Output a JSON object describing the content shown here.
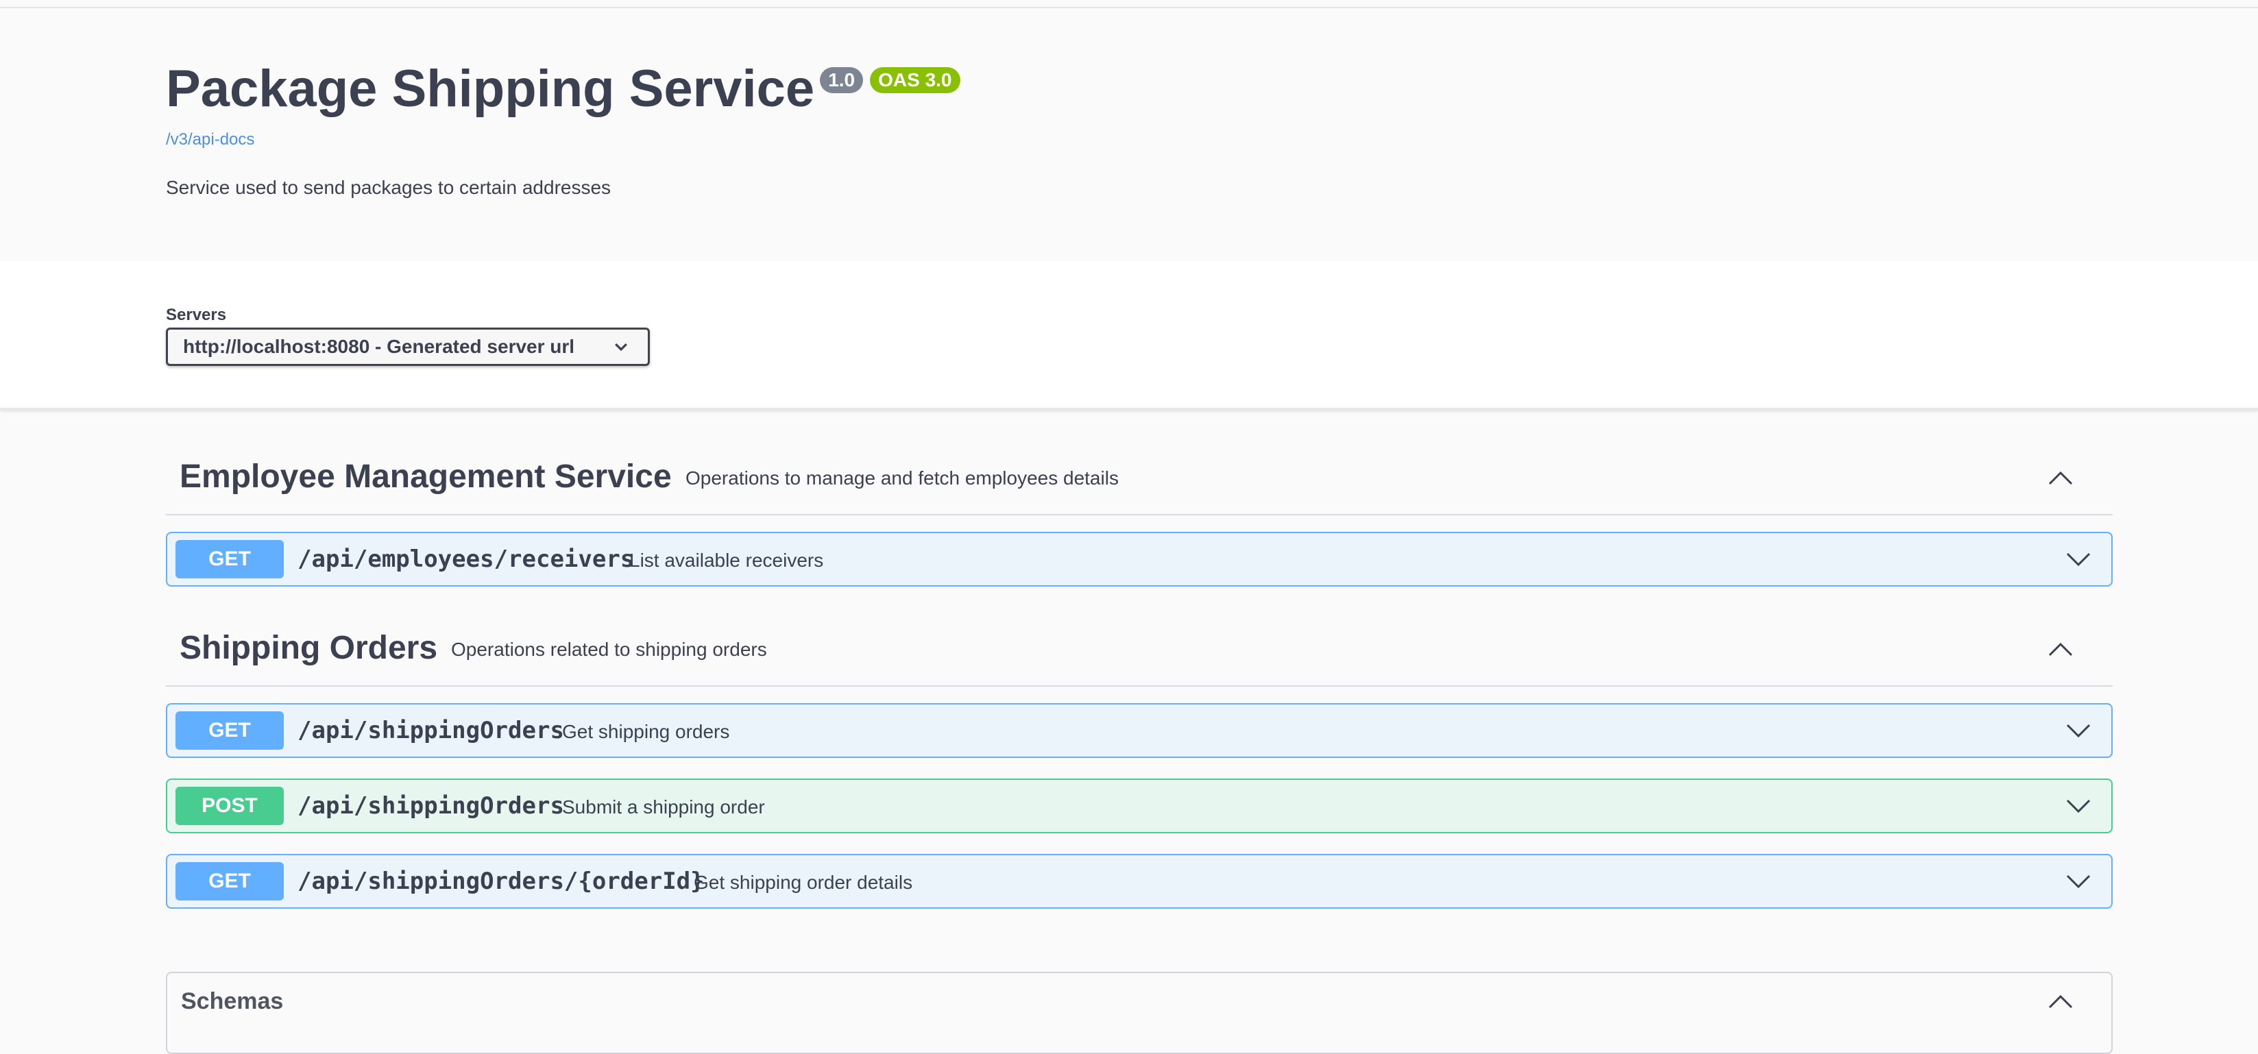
{
  "info": {
    "title": "Package Shipping Service",
    "version_badge": "1.0",
    "oas_badge": "OAS 3.0",
    "spec_link": "/v3/api-docs",
    "description": "Service used to send packages to certain addresses"
  },
  "servers": {
    "label": "Servers",
    "selected": "http://localhost:8080 - Generated server url"
  },
  "tags": [
    {
      "name": "Employee Management Service",
      "description": "Operations to manage and fetch employees details",
      "operations": [
        {
          "method": "GET",
          "path": "/api/employees/receivers",
          "summary": "List available receivers"
        }
      ]
    },
    {
      "name": "Shipping Orders",
      "description": "Operations related to shipping orders",
      "operations": [
        {
          "method": "GET",
          "path": "/api/shippingOrders",
          "summary": "Get shipping orders"
        },
        {
          "method": "POST",
          "path": "/api/shippingOrders",
          "summary": "Submit a shipping order"
        },
        {
          "method": "GET",
          "path": "/api/shippingOrders/{orderId}",
          "summary": "Get shipping order details"
        }
      ]
    }
  ],
  "schemas": {
    "title": "Schemas"
  },
  "colors": {
    "get": "#61affe",
    "post": "#49cc90",
    "version_badge": "#7d8492",
    "oas_badge": "#89bf04",
    "link": "#4990e2"
  },
  "icons": {
    "tag_toggle": "chevron-up-icon",
    "op_toggle": "chevron-down-icon",
    "server_select": "chevron-down-icon"
  }
}
